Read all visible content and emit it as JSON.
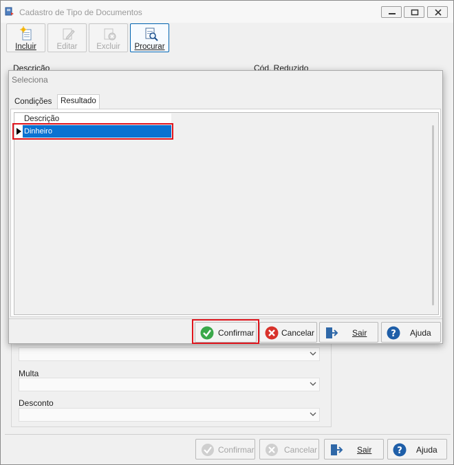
{
  "window": {
    "title": "Cadastro de Tipo de Documentos",
    "controls": [
      "minimize",
      "maximize",
      "close"
    ]
  },
  "toolbar": {
    "incluir": "Incluir",
    "editar": "Editar",
    "excluir": "Excluir",
    "procurar": "Procurar"
  },
  "form": {
    "descricao_label": "Descrição",
    "cod_reduzido_label": "Cód. Reduzido",
    "multa_label": "Multa",
    "desconto_label": "Desconto"
  },
  "dialog": {
    "title": "Seleciona",
    "tabs": [
      "Condições",
      "Resultado"
    ],
    "selected_tab": "Resultado",
    "grid": {
      "columns": [
        "Descrição"
      ],
      "rows": [
        [
          "Dinheiro"
        ]
      ]
    },
    "buttons": {
      "confirmar": "Confirmar",
      "cancelar": "Cancelar",
      "sair": "Sair",
      "ajuda": "Ajuda"
    }
  },
  "footer": {
    "confirmar": "Confirmar",
    "cancelar": "Cancelar",
    "sair": "Sair",
    "ajuda": "Ajuda"
  },
  "colors": {
    "selection": "#0a72d2",
    "highlight": "#e0141c",
    "confirm_green": "#3aa84a",
    "cancel_red": "#d8322b",
    "help_blue": "#1e5ea8"
  }
}
